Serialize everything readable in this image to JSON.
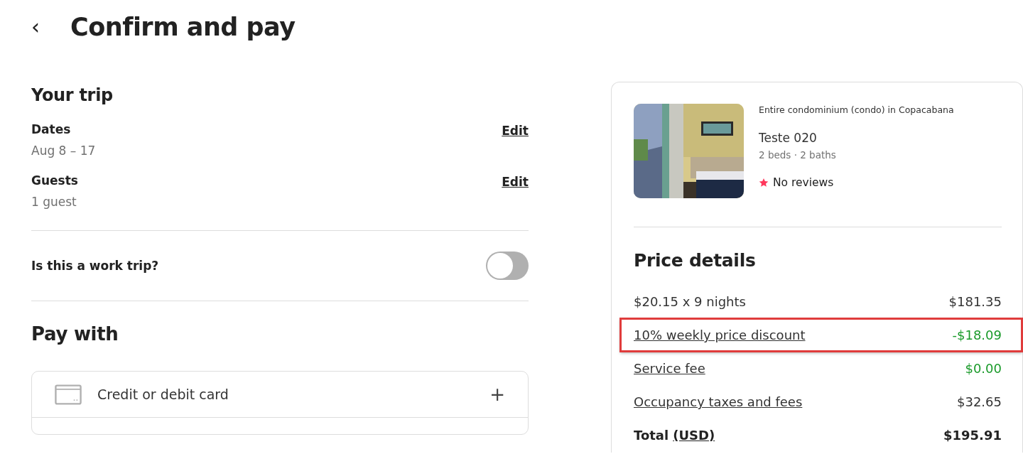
{
  "header": {
    "back": "‹",
    "title": "Confirm and pay"
  },
  "trip": {
    "heading": "Your trip",
    "fields": [
      {
        "label": "Dates",
        "value": "Aug 8 – 17",
        "action": "Edit"
      },
      {
        "label": "Guests",
        "value": "1 guest",
        "action": "Edit"
      }
    ],
    "work_trip": {
      "label": "Is this a work trip?",
      "on": false
    }
  },
  "pay_with": {
    "heading": "Pay with",
    "methods": [
      {
        "label": "Credit or debit card",
        "action": "+"
      }
    ]
  },
  "listing": {
    "type": "Entire condominium (condo) in Copacabana",
    "name": "Teste 020",
    "details": "2 beds · 2 baths",
    "rating": "No reviews"
  },
  "price_details": {
    "heading": "Price details",
    "lines": [
      {
        "kind": "normal",
        "label": "$20.15 x 9 nights",
        "amount": "$181.35",
        "link": false,
        "highlighted": false
      },
      {
        "kind": "credit",
        "label": "10% weekly price discount",
        "amount": "-$18.09",
        "link": true,
        "highlighted": true
      },
      {
        "kind": "credit",
        "label": "Service fee",
        "amount": "$0.00",
        "link": true,
        "highlighted": false
      },
      {
        "kind": "normal",
        "label": "Occupancy taxes and fees",
        "amount": "$32.65",
        "link": true,
        "highlighted": false
      }
    ],
    "total": {
      "label": "Total",
      "currency": "(USD)",
      "amount": "$195.91"
    }
  }
}
